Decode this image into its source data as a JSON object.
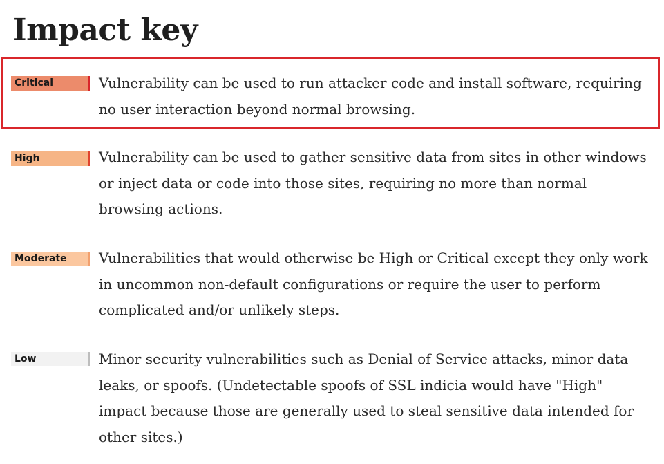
{
  "page": {
    "title": "Impact key"
  },
  "colors": {
    "critical": "#ec8b6b",
    "critical_edge": "#d9262b",
    "high": "#f6b586",
    "high_edge": "#e0442f",
    "moderate": "#fbc79f",
    "moderate_edge": "#f2a06e",
    "low": "#f2f2f2",
    "low_edge": "#bdbdbd",
    "highlight_border": "#d9262b"
  },
  "impact_levels": [
    {
      "label": "Critical",
      "description": "Vulnerability can be used to run attacker code and install software, requiring no user interaction beyond normal browsing."
    },
    {
      "label": "High",
      "description": "Vulnerability can be used to gather sensitive data from sites in other windows or inject data or code into those sites, requiring no more than normal browsing actions."
    },
    {
      "label": "Moderate",
      "description": "Vulnerabilities that would otherwise be High or Critical except they only work in uncommon non-default configurations or require the user to perform complicated and/or unlikely steps."
    },
    {
      "label": "Low",
      "description": "Minor security vulnerabilities such as Denial of Service attacks, minor data leaks, or spoofs. (Undetectable spoofs of SSL indicia would have \"High\" impact because those are generally used to steal sensitive data intended for other sites.)"
    }
  ]
}
